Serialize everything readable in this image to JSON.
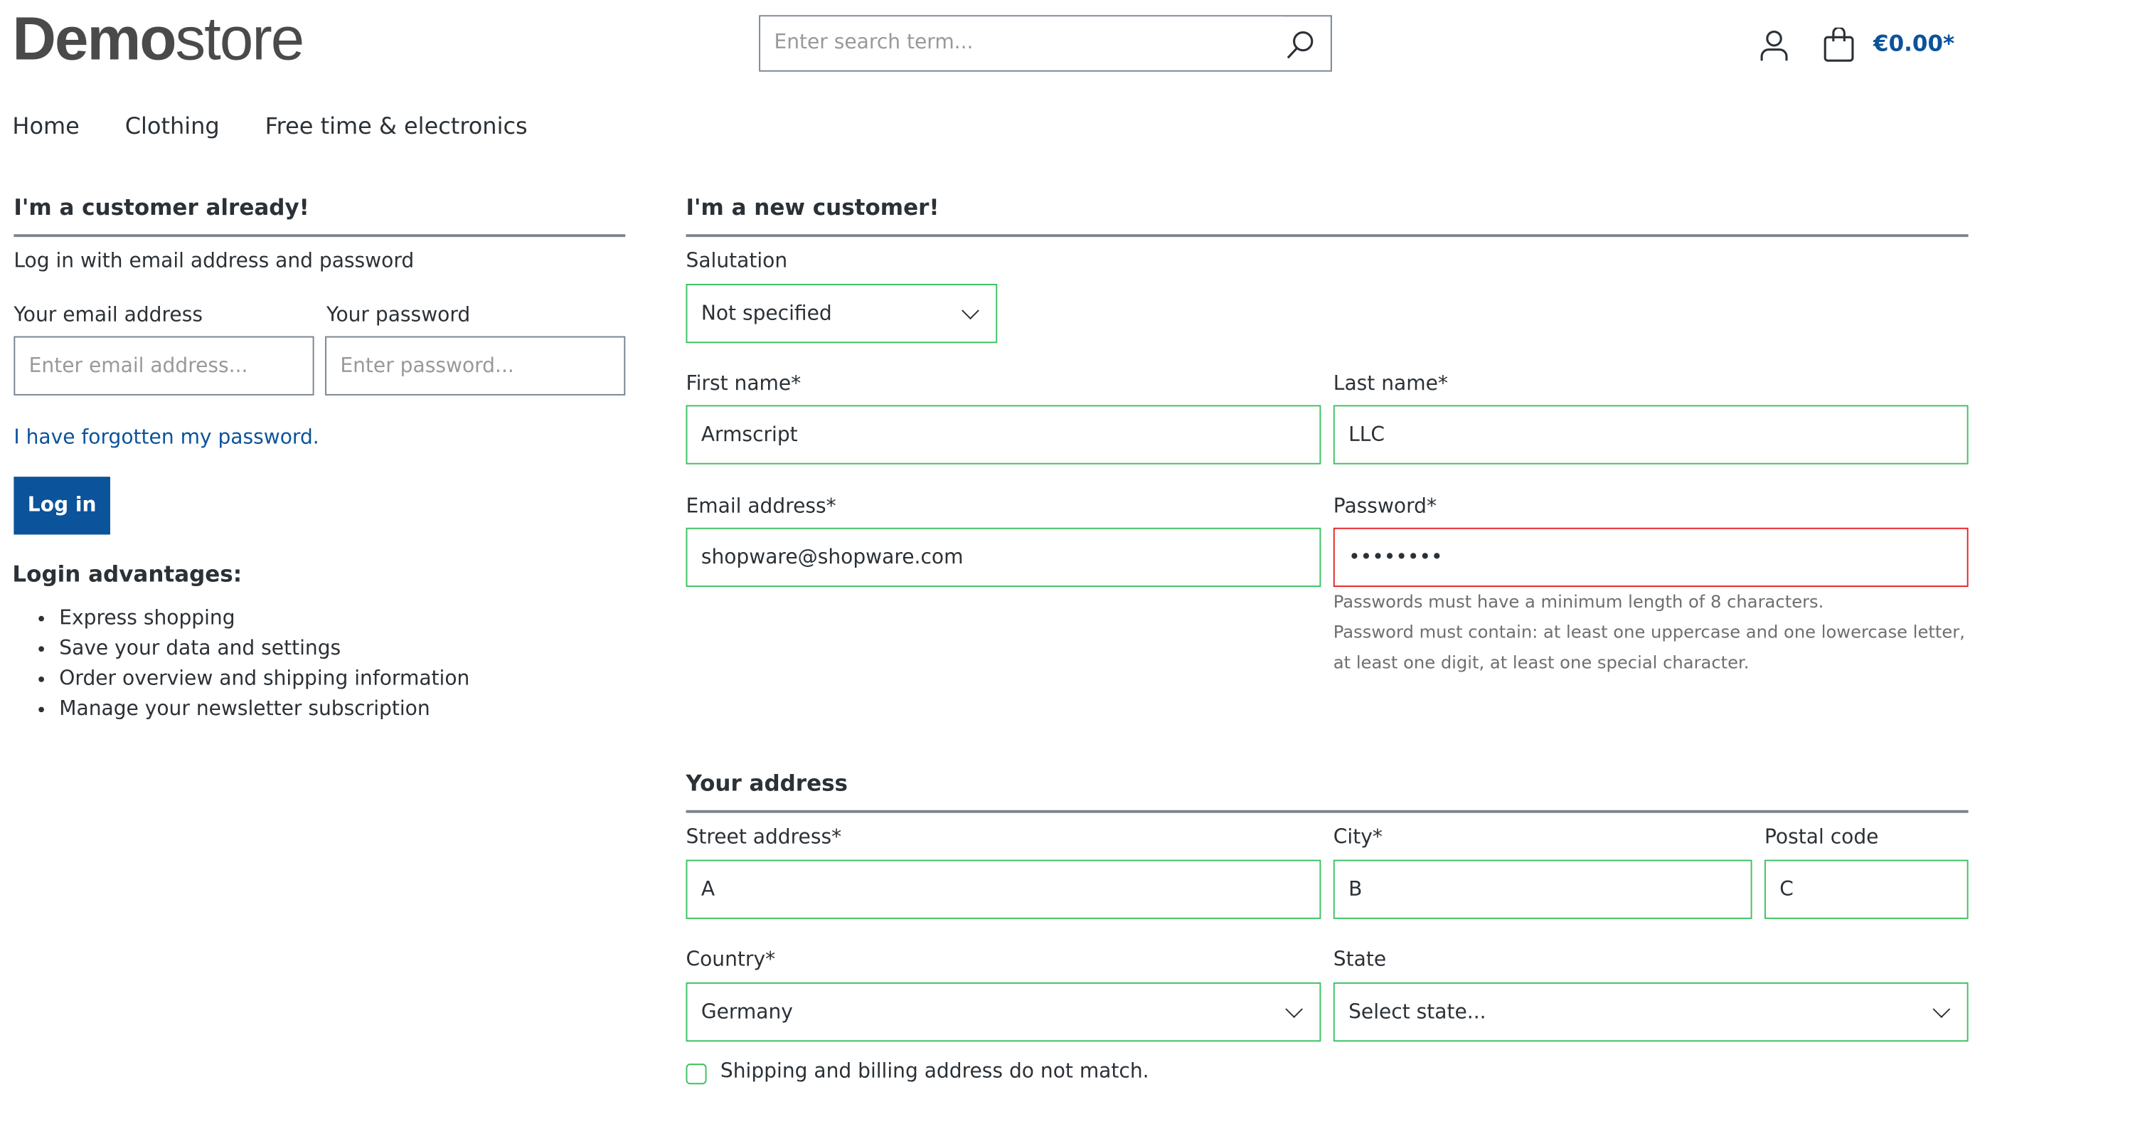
{
  "header": {
    "logo_bold": "Demo",
    "logo_light": "store",
    "search_placeholder": "Enter search term...",
    "cart_total": "€0.00*",
    "accent": "#0b539b"
  },
  "nav": [
    "Home",
    "Clothing",
    "Free time & electronics"
  ],
  "login": {
    "title": "I'm a customer already!",
    "subtitle": "Log in with email address and password",
    "email_label": "Your email address",
    "email_placeholder": "Enter email address...",
    "password_label": "Your password",
    "password_placeholder": "Enter password...",
    "forgot": "I have forgotten my password.",
    "button": "Log in",
    "advantages_title": "Login advantages:",
    "advantages": [
      "Express shopping",
      "Save your data and settings",
      "Order overview and shipping information",
      "Manage your newsletter subscription"
    ]
  },
  "register": {
    "title": "I'm a new customer!",
    "salutation_label": "Salutation",
    "salutation_value": "Not specified",
    "first_name_label": "First name*",
    "first_name": "Armscript",
    "last_name_label": "Last name*",
    "last_name": "LLC",
    "email_label": "Email address*",
    "email": "shopware@shopware.com",
    "password_label": "Password*",
    "password": "12345678",
    "password_hint1": "Passwords must have a minimum length of 8 characters.",
    "password_hint2": "Password must contain: at least one uppercase and one lowercase letter, at least one digit, at least one special character."
  },
  "address": {
    "title": "Your address",
    "street_label": "Street address*",
    "street": "A",
    "city_label": "City*",
    "city": "B",
    "postal_label": "Postal code",
    "postal": "C",
    "country_label": "Country*",
    "country": "Germany",
    "state_label": "State",
    "state": "Select state...",
    "different_shipping": "Shipping and billing address do not match."
  },
  "colors": {
    "valid": "#3cc261",
    "invalid": "#e52427"
  }
}
